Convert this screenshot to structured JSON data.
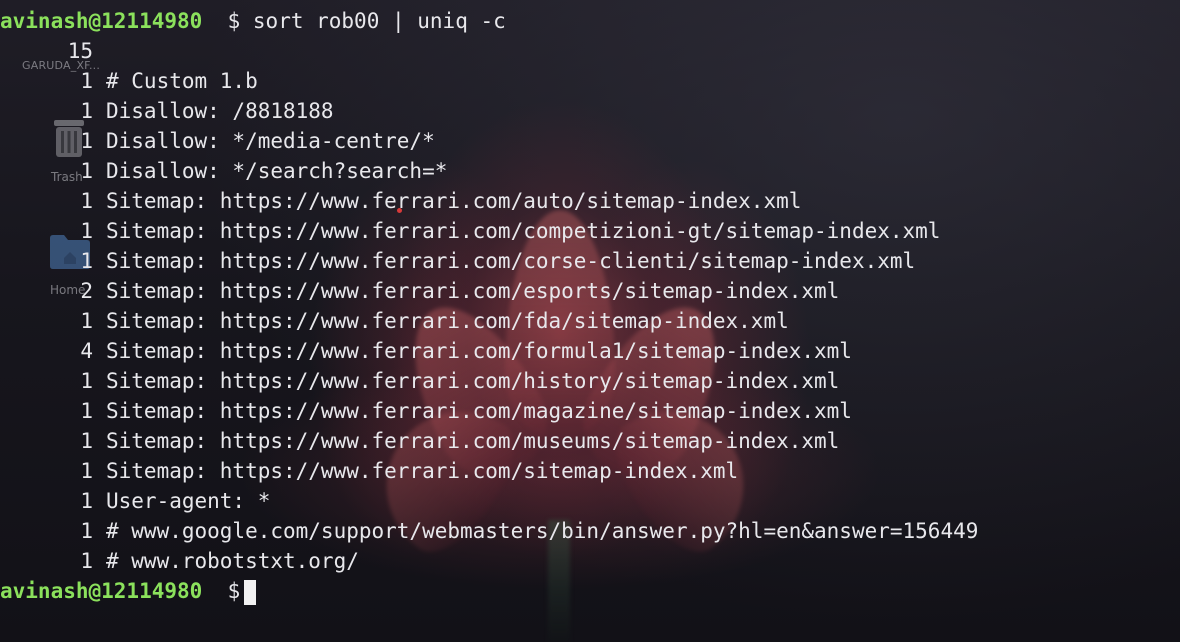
{
  "desktop": {
    "garuda_label": "GARUDA_XF...",
    "trash_label": "Trash",
    "home_label": "Home"
  },
  "terminal": {
    "prompt_user": "avinash@12114980",
    "prompt_symbol": "$",
    "command": "sort rob00 | uniq -c",
    "output": [
      {
        "count": "15",
        "text": ""
      },
      {
        "count": "1",
        "text": "# Custom 1.b"
      },
      {
        "count": "1",
        "text": "Disallow: /8818188"
      },
      {
        "count": "1",
        "text": "Disallow: */media-centre/*"
      },
      {
        "count": "1",
        "text": "Disallow: */search?search=*"
      },
      {
        "count": "1",
        "text": "Sitemap: https://www.ferrari.com/auto/sitemap-index.xml"
      },
      {
        "count": "1",
        "text": "Sitemap: https://www.ferrari.com/competizioni-gt/sitemap-index.xml"
      },
      {
        "count": "1",
        "text": "Sitemap: https://www.ferrari.com/corse-clienti/sitemap-index.xml"
      },
      {
        "count": "2",
        "text": "Sitemap: https://www.ferrari.com/esports/sitemap-index.xml"
      },
      {
        "count": "1",
        "text": "Sitemap: https://www.ferrari.com/fda/sitemap-index.xml"
      },
      {
        "count": "4",
        "text": "Sitemap: https://www.ferrari.com/formula1/sitemap-index.xml"
      },
      {
        "count": "1",
        "text": "Sitemap: https://www.ferrari.com/history/sitemap-index.xml"
      },
      {
        "count": "1",
        "text": "Sitemap: https://www.ferrari.com/magazine/sitemap-index.xml"
      },
      {
        "count": "1",
        "text": "Sitemap: https://www.ferrari.com/museums/sitemap-index.xml"
      },
      {
        "count": "1",
        "text": "Sitemap: https://www.ferrari.com/sitemap-index.xml"
      },
      {
        "count": "1",
        "text": "User-agent: *"
      },
      {
        "count": "1",
        "text": "# www.google.com/support/webmasters/bin/answer.py?hl=en&answer=156449"
      },
      {
        "count": "1",
        "text": "# www.robotstxt.org/"
      }
    ]
  },
  "colors": {
    "prompt_user": "#8be15c",
    "text": "#e8e8ec",
    "background": "#17161d"
  }
}
